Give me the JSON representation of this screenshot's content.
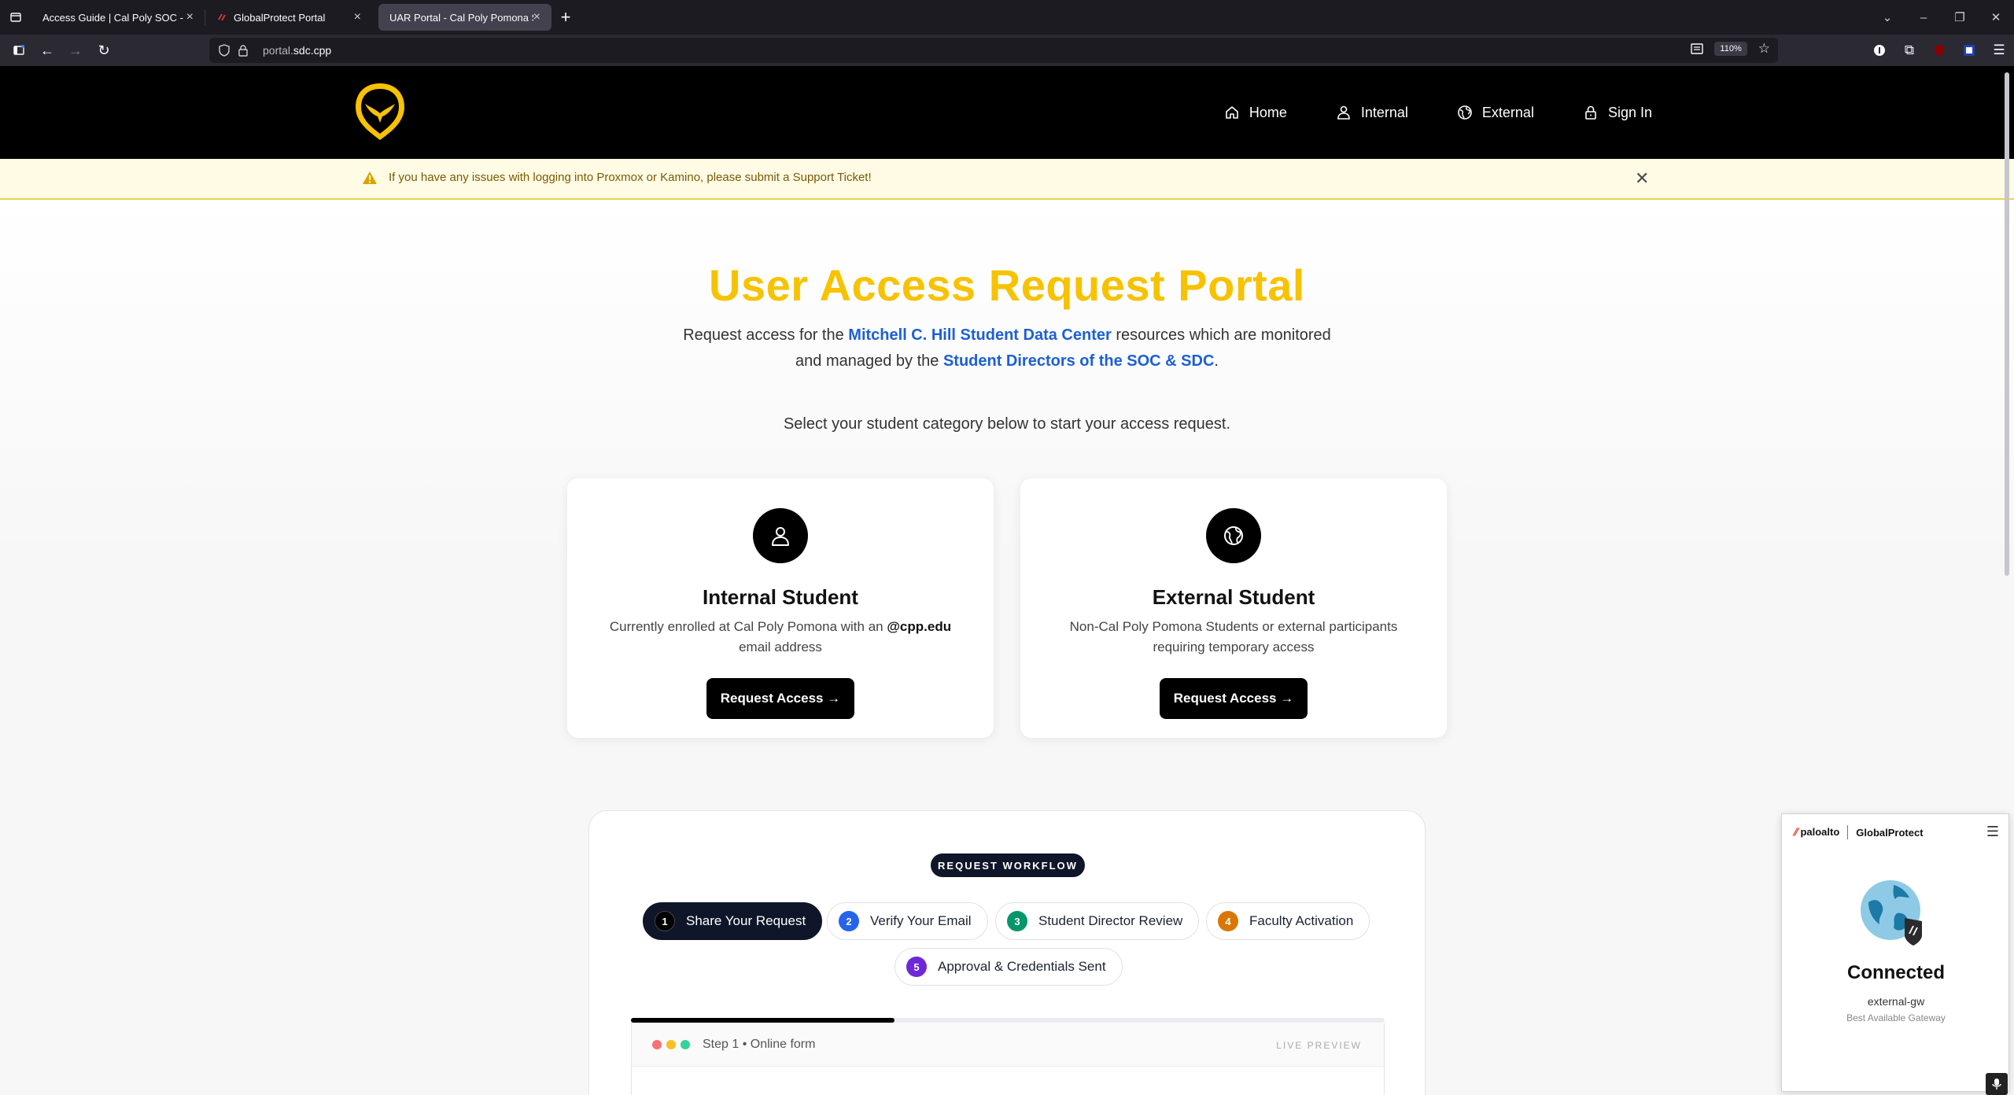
{
  "browser": {
    "tabs": [
      {
        "title": "Access Guide | Cal Poly SOC - How t",
        "active": false
      },
      {
        "title": "GlobalProtect Portal",
        "active": false
      },
      {
        "title": "UAR Portal - Cal Poly Pomona SOC",
        "active": true
      }
    ],
    "new_tab": "+",
    "url_prefix": "portal.",
    "url_host": "sdc.cpp",
    "zoom": "110%"
  },
  "header": {
    "nav": [
      {
        "label": "Home",
        "icon": "home-icon"
      },
      {
        "label": "Internal",
        "icon": "user-icon"
      },
      {
        "label": "External",
        "icon": "globe-icon"
      },
      {
        "label": "Sign In",
        "icon": "lock-icon"
      }
    ]
  },
  "alert": {
    "text": "If you have any issues with logging into Proxmox or Kamino, please submit a Support Ticket!",
    "close": "✕"
  },
  "hero": {
    "title": "User Access Request Portal",
    "sub_1": "Request access for the ",
    "sub_link_1": "Mitchell C. Hill Student Data Center",
    "sub_2": " resources which are monitored and managed by the ",
    "sub_link_2": "Student Directors of the SOC & SDC",
    "sub_3": ".",
    "select_text": "Select your student category below to start your access request."
  },
  "cards": {
    "internal": {
      "title": "Internal Student",
      "desc_1": "Currently enrolled at Cal Poly Pomona with an ",
      "desc_bold": "@cpp.edu",
      "desc_2": " email address",
      "button": "Request Access →"
    },
    "external": {
      "title": "External Student",
      "desc": "Non-Cal Poly Pomona Students or external participants requiring temporary access",
      "button": "Request Access →"
    }
  },
  "workflow": {
    "badge": "REQUEST WORKFLOW",
    "steps": [
      {
        "num": "1",
        "label": "Share Your Request",
        "color": "#000000"
      },
      {
        "num": "2",
        "label": "Verify Your Email",
        "color": "#2563eb"
      },
      {
        "num": "3",
        "label": "Student Director Review",
        "color": "#059669"
      },
      {
        "num": "4",
        "label": "Faculty Activation",
        "color": "#d97706"
      },
      {
        "num": "5",
        "label": "Approval & Credentials Sent",
        "color": "#6d28d9"
      }
    ],
    "progress_fraction": 0.35,
    "preview": {
      "title": "Step 1 • Online form",
      "live": "LIVE PREVIEW"
    }
  },
  "globalprotect": {
    "brand": "paloalto",
    "product": "GlobalProtect",
    "status": "Connected",
    "gateway": "external-gw",
    "gateway_sub": "Best Available Gateway"
  },
  "colors": {
    "brand_yellow": "#f7c200",
    "link_blue": "#1c5fd6",
    "alert_bg": "#fffbe5",
    "dark_navy": "#0f1629"
  }
}
